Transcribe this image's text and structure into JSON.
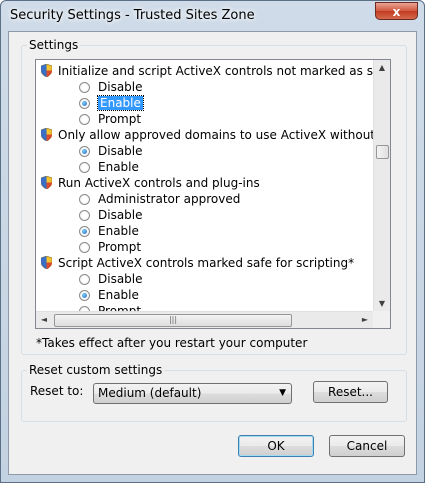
{
  "window": {
    "title": "Security Settings - Trusted Sites Zone",
    "close_label": "x"
  },
  "settings": {
    "group_label": "Settings",
    "items": [
      {
        "kind": "header",
        "text": "Initialize and script ActiveX controls not marked as safe for sc"
      },
      {
        "kind": "option",
        "text": "Disable",
        "checked": false
      },
      {
        "kind": "option",
        "text": "Enable",
        "checked": true,
        "selected": true
      },
      {
        "kind": "option",
        "text": "Prompt",
        "checked": false
      },
      {
        "kind": "header",
        "text": "Only allow approved domains to use ActiveX without prompt"
      },
      {
        "kind": "option",
        "text": "Disable",
        "checked": true
      },
      {
        "kind": "option",
        "text": "Enable",
        "checked": false
      },
      {
        "kind": "header",
        "text": "Run ActiveX controls and plug-ins"
      },
      {
        "kind": "option",
        "text": "Administrator approved",
        "checked": false
      },
      {
        "kind": "option",
        "text": "Disable",
        "checked": false
      },
      {
        "kind": "option",
        "text": "Enable",
        "checked": true
      },
      {
        "kind": "option",
        "text": "Prompt",
        "checked": false
      },
      {
        "kind": "header",
        "text": "Script ActiveX controls marked safe for scripting*"
      },
      {
        "kind": "option",
        "text": "Disable",
        "checked": false
      },
      {
        "kind": "option",
        "text": "Enable",
        "checked": true
      },
      {
        "kind": "option",
        "text": "Prompt",
        "checked": false
      }
    ],
    "note": "*Takes effect after you restart your computer"
  },
  "reset": {
    "group_label": "Reset custom settings",
    "reset_to_label": "Reset to:",
    "selected_level": "Medium (default)",
    "reset_button": "Reset..."
  },
  "buttons": {
    "ok": "OK",
    "cancel": "Cancel"
  },
  "icons": {
    "item_icon": "shield-icon",
    "close": "close-icon"
  }
}
